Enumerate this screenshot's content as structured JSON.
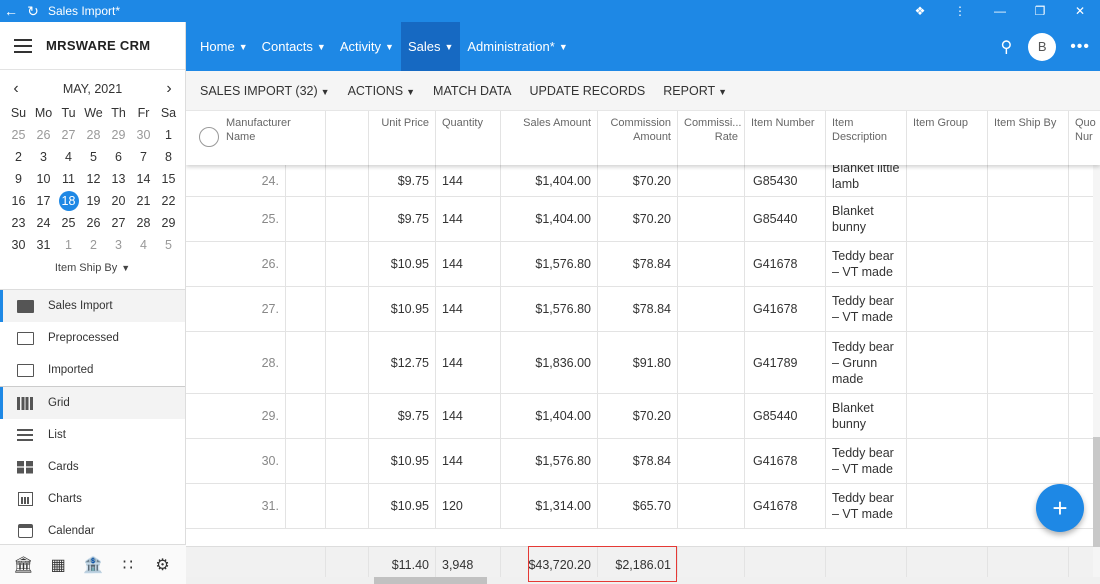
{
  "window": {
    "title": "Sales Import*"
  },
  "app": {
    "brand": "MRSWARE CRM",
    "user_initial": "B",
    "accent": "#1e88e5"
  },
  "calendar": {
    "month_label": "MAY, 2021",
    "weekdays": [
      "Su",
      "Mo",
      "Tu",
      "We",
      "Th",
      "Fr",
      "Sa"
    ],
    "weeks": [
      [
        "25",
        "26",
        "27",
        "28",
        "29",
        "30",
        "1"
      ],
      [
        "2",
        "3",
        "4",
        "5",
        "6",
        "7",
        "8"
      ],
      [
        "9",
        "10",
        "11",
        "12",
        "13",
        "14",
        "15"
      ],
      [
        "16",
        "17",
        "18",
        "19",
        "20",
        "21",
        "22"
      ],
      [
        "23",
        "24",
        "25",
        "26",
        "27",
        "28",
        "29"
      ],
      [
        "30",
        "31",
        "1",
        "2",
        "3",
        "4",
        "5"
      ]
    ],
    "today": "18",
    "filter_label": "Item Ship By"
  },
  "sidebar": {
    "folders": [
      {
        "label": "Sales Import",
        "active": true,
        "icon": "folder-filled-icon"
      },
      {
        "label": "Preprocessed",
        "active": false,
        "icon": "folder-icon"
      },
      {
        "label": "Imported",
        "active": false,
        "icon": "folder-icon"
      }
    ],
    "views": [
      {
        "label": "Grid",
        "active": true,
        "icon": "grid-icon"
      },
      {
        "label": "List",
        "active": false,
        "icon": "list-icon"
      },
      {
        "label": "Cards",
        "active": false,
        "icon": "cards-icon"
      },
      {
        "label": "Charts",
        "active": false,
        "icon": "chart-icon"
      },
      {
        "label": "Calendar",
        "active": false,
        "icon": "calendar-icon"
      }
    ],
    "bottom_icons": [
      "building-icon",
      "office-icon",
      "bank-icon",
      "apps-icon",
      "settings-icon"
    ]
  },
  "topnav": {
    "menus": [
      {
        "label": "Home",
        "active": false
      },
      {
        "label": "Contacts",
        "active": false
      },
      {
        "label": "Activity",
        "active": false
      },
      {
        "label": "Sales",
        "active": true
      },
      {
        "label": "Administration*",
        "active": false
      }
    ]
  },
  "toolbar": {
    "sales_import": "SALES IMPORT (32)",
    "actions": "ACTIONS",
    "match_data": "MATCH DATA",
    "update_records": "UPDATE RECORDS",
    "report": "REPORT"
  },
  "grid": {
    "headers": {
      "manufacturer": "Manufacturer Name",
      "unit_price": "Unit Price",
      "quantity": "Quantity",
      "sales_amount": "Sales Amount",
      "commission_amount": "Commission Amount",
      "commission_rate": "Commissi... Rate",
      "item_number": "Item Number",
      "item_description": "Item Description",
      "item_group": "Item Group",
      "item_ship_by": "Item Ship By",
      "quantity_number": "Quo Nur"
    },
    "rows": [
      {
        "num": "24.",
        "unit_price": "$9.75",
        "qty": "144",
        "sales": "$1,404.00",
        "comm": "$70.20",
        "item": "G85430",
        "desc": [
          "Blanket little",
          "lamb"
        ]
      },
      {
        "num": "25.",
        "unit_price": "$9.75",
        "qty": "144",
        "sales": "$1,404.00",
        "comm": "$70.20",
        "item": "G85440",
        "desc": [
          "Blanket",
          "bunny"
        ]
      },
      {
        "num": "26.",
        "unit_price": "$10.95",
        "qty": "144",
        "sales": "$1,576.80",
        "comm": "$78.84",
        "item": "G41678",
        "desc": [
          "Teddy bear",
          "– VT made"
        ]
      },
      {
        "num": "27.",
        "unit_price": "$10.95",
        "qty": "144",
        "sales": "$1,576.80",
        "comm": "$78.84",
        "item": "G41678",
        "desc": [
          "Teddy bear",
          "– VT made"
        ]
      },
      {
        "num": "28.",
        "unit_price": "$12.75",
        "qty": "144",
        "sales": "$1,836.00",
        "comm": "$91.80",
        "item": "G41789",
        "desc": [
          "Teddy bear",
          "– Grunn",
          "made"
        ]
      },
      {
        "num": "29.",
        "unit_price": "$9.75",
        "qty": "144",
        "sales": "$1,404.00",
        "comm": "$70.20",
        "item": "G85440",
        "desc": [
          "Blanket",
          "bunny"
        ]
      },
      {
        "num": "30.",
        "unit_price": "$10.95",
        "qty": "144",
        "sales": "$1,576.80",
        "comm": "$78.84",
        "item": "G41678",
        "desc": [
          "Teddy bear",
          "– VT made"
        ]
      },
      {
        "num": "31.",
        "unit_price": "$10.95",
        "qty": "120",
        "sales": "$1,314.00",
        "comm": "$65.70",
        "item": "G41678",
        "desc": [
          "Teddy bear",
          "– VT made"
        ]
      }
    ],
    "totals": {
      "unit_price": "$11.40",
      "qty": "3,948",
      "sales": "$43,720.20",
      "comm": "$2,186.01"
    }
  },
  "fab": {
    "label": "+"
  }
}
